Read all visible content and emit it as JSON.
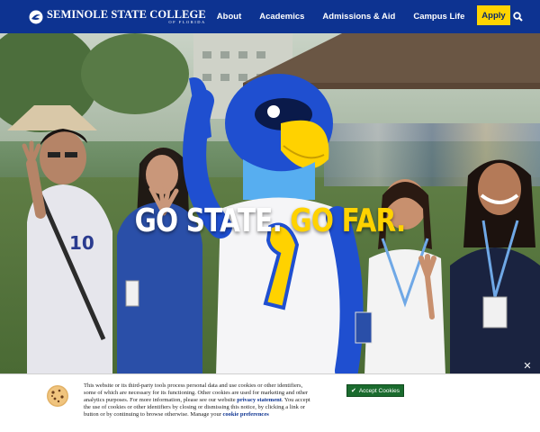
{
  "header": {
    "logo_name": "SEMINOLE STATE COLLEGE",
    "logo_sub": "OF FLORIDA",
    "nav": [
      "About",
      "Academics",
      "Admissions & Aid",
      "Campus Life"
    ],
    "apply_label": "Apply",
    "icons": [
      "directory-icon",
      "search-icon",
      "apps-grid-icon"
    ]
  },
  "hero": {
    "headline_part1": "GO STATE.",
    "headline_part2": "GO FAR.",
    "shirt_text": "10"
  },
  "cookie": {
    "text_1": "This website or its third-party tools process personal data and use cookies or other identifiers, some of which are necessary for its functioning. Other cookies are used for marketing and other analytics purposes. For more information, please see our website",
    "privacy_link": "privacy statement",
    "text_2": ". You accept the use of cookies or other identifiers by closing or dismissing this notice, by clicking a link or button or by continuing to browse otherwise. Manage your",
    "preferences_link": "cookie preferences",
    "accept_label": "Accept Cookies",
    "close_label": "✕"
  },
  "colors": {
    "header_blue": "#0d3391",
    "apply_yellow": "#ffd400",
    "headline_yellow": "#ffd200",
    "accept_green": "#1a6b2e"
  }
}
